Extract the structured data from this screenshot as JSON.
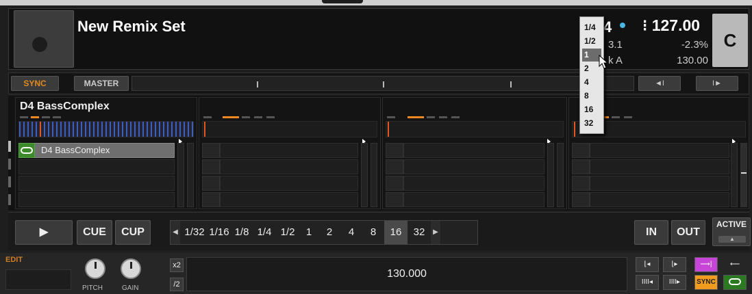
{
  "deck": {
    "title": "New Remix Set",
    "key_value": "4",
    "bpm": "127.00",
    "position": "3.1",
    "deck_label": "k A",
    "pitch_percent": "-2.3%",
    "tempo": "130.00",
    "deck_letter": "C",
    "key_dot_color": "#4ab7e0"
  },
  "sync_row": {
    "sync_label": "SYNC",
    "master_label": "MASTER",
    "prev_label": "◄I",
    "next_label": "I►"
  },
  "slots": [
    {
      "name": "D4 BassComplex",
      "active_cell": "D4 BassComplex"
    },
    {
      "name": ""
    },
    {
      "name": ""
    },
    {
      "name": ""
    }
  ],
  "transport": {
    "play_label": "▶",
    "cue_label": "CUE",
    "cup_label": "CUP",
    "lengths": [
      "1/32",
      "1/16",
      "1/8",
      "1/4",
      "1/2",
      "1",
      "2",
      "4",
      "8",
      "16",
      "32"
    ],
    "selected_length": "16",
    "in_label": "IN",
    "out_label": "OUT",
    "active_label": "ACTIVE",
    "active_sub": "▲"
  },
  "bottom": {
    "edit_label": "EDIT",
    "pitch_label": "PITCH",
    "gain_label": "GAIN",
    "x2_label": "x2",
    "div2_label": "/2",
    "bpm_value": "130.000",
    "sync_label": "SYNC",
    "accent_purple": "#c745d6",
    "accent_orange": "#f09a20",
    "accent_green": "#2b7a21"
  },
  "dropdown": {
    "options": [
      "1/4",
      "1/2",
      "1",
      "2",
      "4",
      "8",
      "16",
      "32"
    ],
    "selected": "1"
  }
}
